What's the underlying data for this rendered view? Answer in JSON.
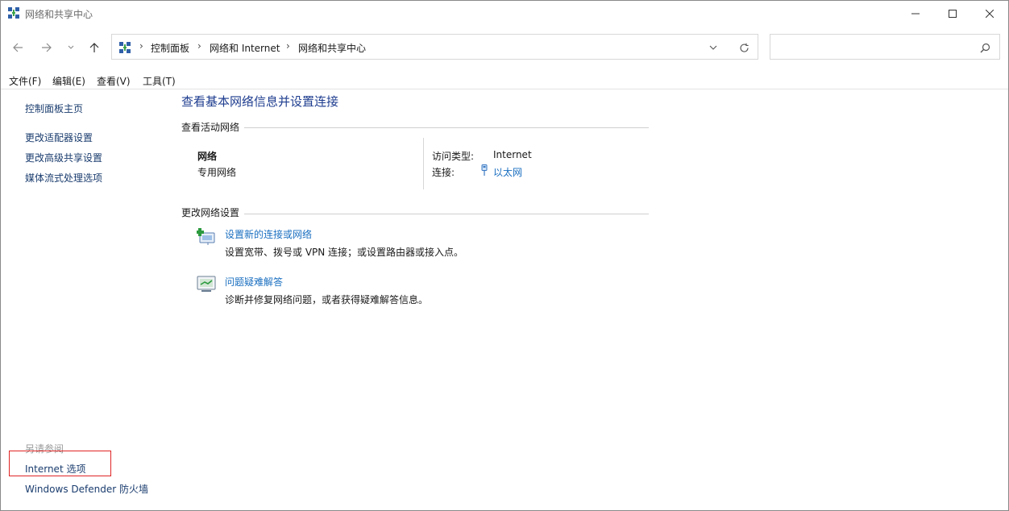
{
  "window": {
    "title": "网络和共享中心"
  },
  "breadcrumbs": [
    "控制面板",
    "网络和 Internet",
    "网络和共享中心"
  ],
  "search": {
    "placeholder": ""
  },
  "menu": [
    "文件(F)",
    "编辑(E)",
    "查看(V)",
    "工具(T)"
  ],
  "left_pane": {
    "links": [
      "控制面板主页",
      "更改适配器设置",
      "更改高级共享设置",
      "媒体流式处理选项"
    ],
    "see_also_label": "另请参阅",
    "see_also": [
      "Internet 选项",
      "Windows Defender 防火墙"
    ]
  },
  "main": {
    "title": "查看基本网络信息并设置连接",
    "active_networks_heading": "查看活动网络",
    "network": {
      "name": "网络",
      "profile": "专用网络",
      "access_type_label": "访问类型:",
      "access_type_value": "Internet",
      "connection_label": "连接:",
      "connection_value": "以太网"
    },
    "change_settings_heading": "更改网络设置",
    "tasks": [
      {
        "link": "设置新的连接或网络",
        "desc": "设置宽带、拨号或 VPN 连接；或设置路由器或接入点。",
        "icon": "new-connection-icon"
      },
      {
        "link": "问题疑难解答",
        "desc": "诊断并修复网络问题，或者获得疑难解答信息。",
        "icon": "troubleshoot-icon"
      }
    ]
  },
  "colors": {
    "link": "#1a6fc0",
    "nav_link": "#1a3c6e",
    "title": "#1e3d8f",
    "highlight": "#e02424"
  }
}
